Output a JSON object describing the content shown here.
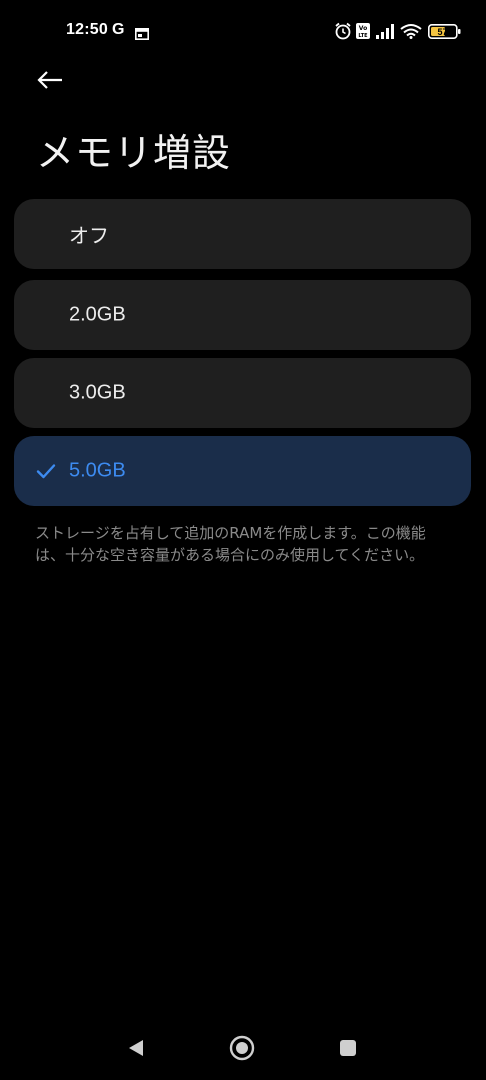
{
  "status_bar": {
    "time": "12:50",
    "g_label": "G",
    "battery_level": "57",
    "icons": [
      "calendar-icon",
      "alarm-icon",
      "volte-icon",
      "signal-icon",
      "wifi-icon",
      "battery-icon"
    ]
  },
  "header": {
    "title": "メモリ増設",
    "back_icon": "back-arrow-icon"
  },
  "options": [
    {
      "label": "オフ",
      "selected": false
    },
    {
      "label": "2.0GB",
      "selected": false
    },
    {
      "label": "3.0GB",
      "selected": false
    },
    {
      "label": "5.0GB",
      "selected": true
    }
  ],
  "description": "ストレージを占有して追加のRAMを作成します。この機能は、十分な空き容量がある場合にのみ使用してください。",
  "nav_bar": {
    "icons": [
      "nav-back-icon",
      "nav-home-icon",
      "nav-recents-icon"
    ]
  },
  "colors": {
    "background": "#000000",
    "option_bg": "#1f1f1f",
    "selected_bg": "#1a2d4a",
    "accent": "#3d8bf0",
    "description_text": "#8a8a8a"
  }
}
